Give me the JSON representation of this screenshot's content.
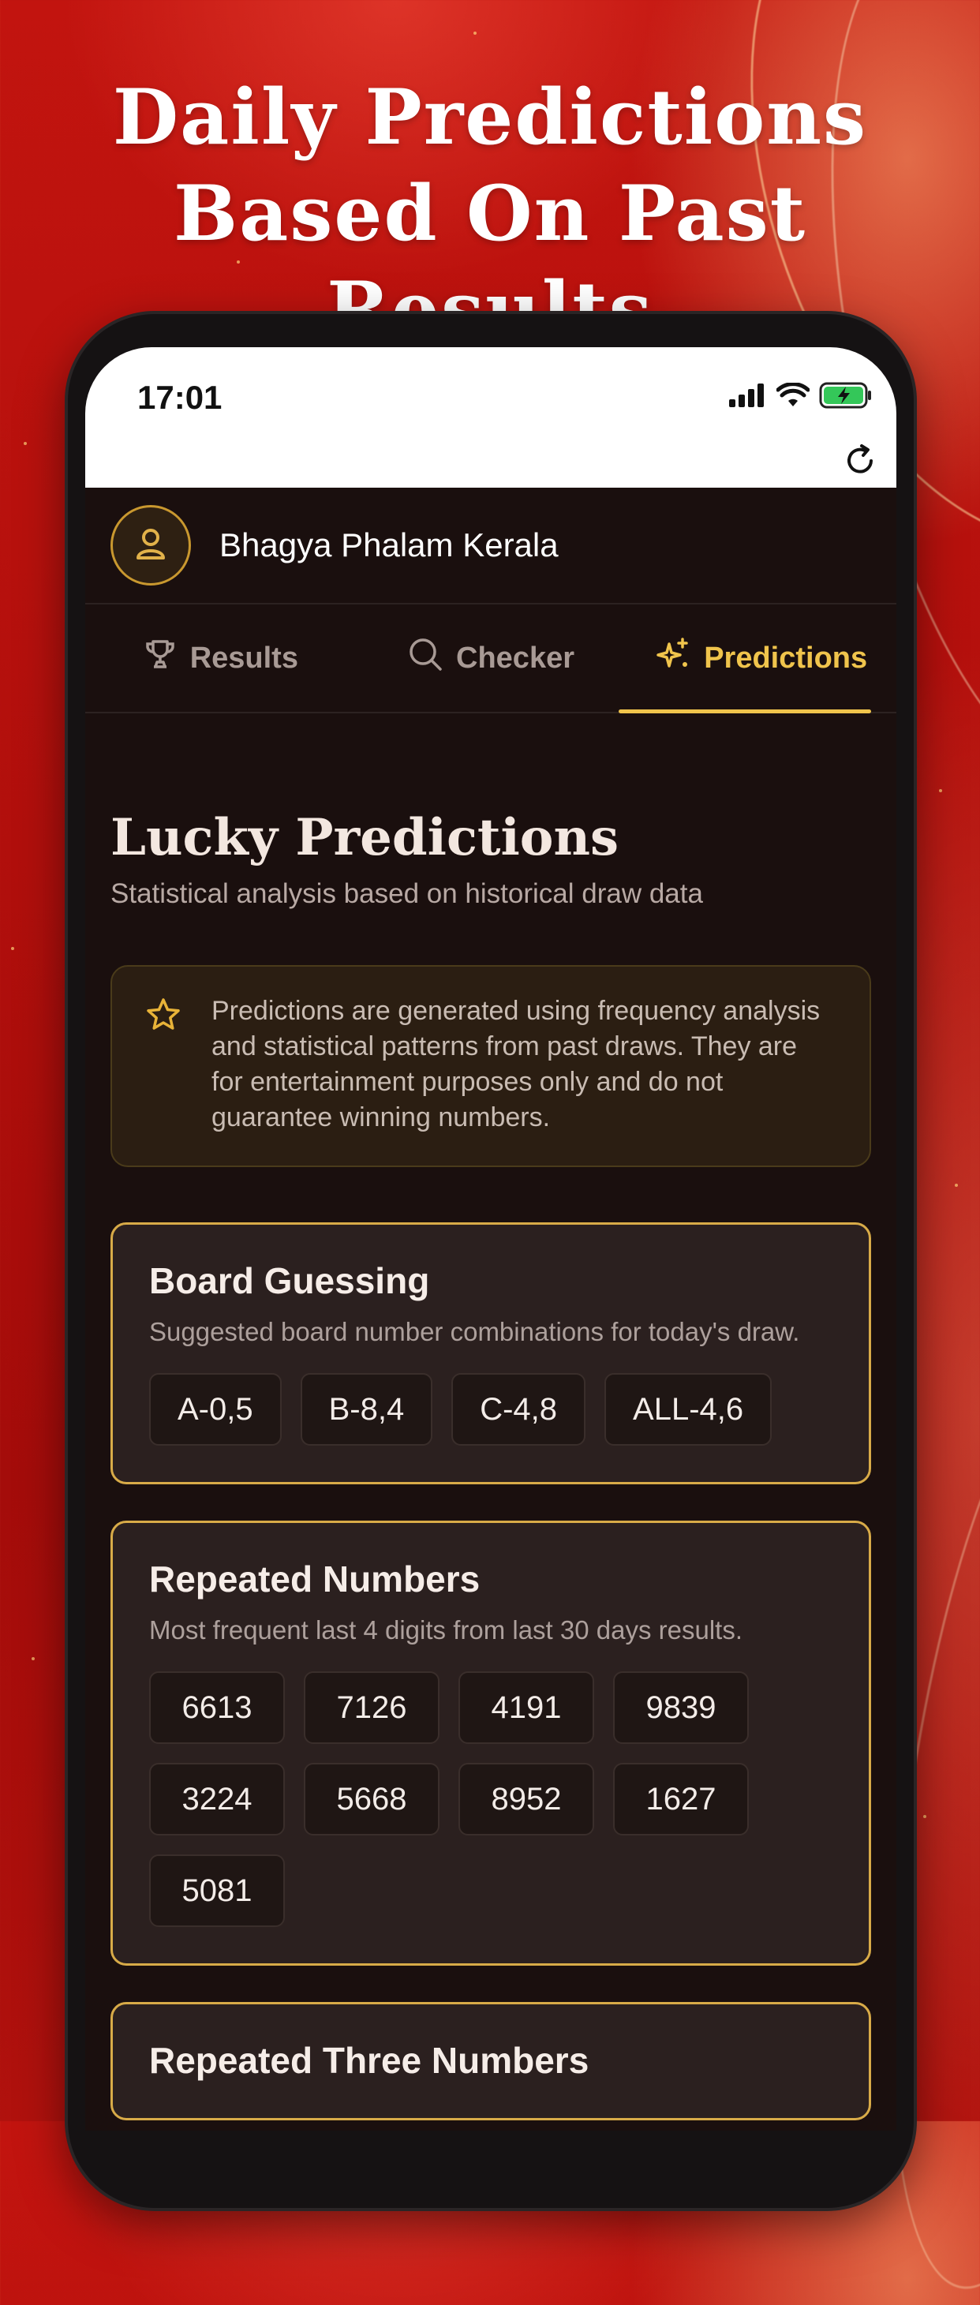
{
  "headline": {
    "line1": "Daily Predictions",
    "line2": "Based On Past Results"
  },
  "status_bar": {
    "time": "17:01"
  },
  "app": {
    "title": "Bhagya Phalam Kerala"
  },
  "tabs": [
    {
      "label": "Results",
      "icon": "trophy-icon"
    },
    {
      "label": "Checker",
      "icon": "search-icon"
    },
    {
      "label": "Predictions",
      "icon": "sparkles-icon",
      "active": true
    }
  ],
  "page": {
    "title": "Lucky Predictions",
    "subtitle": "Statistical analysis based on historical draw data"
  },
  "notice": {
    "icon": "star-icon",
    "text": "Predictions are generated using frequency analysis and statistical patterns from past draws. They are for entertainment purposes only and do not guarantee winning numbers."
  },
  "board_guessing": {
    "title": "Board Guessing",
    "subtitle": "Suggested board number combinations for today's draw.",
    "chips": [
      "A-0,5",
      "B-8,4",
      "C-4,8",
      "ALL-4,6"
    ]
  },
  "repeated_numbers": {
    "title": "Repeated Numbers",
    "subtitle": "Most frequent last 4 digits from last 30 days results.",
    "chips": [
      "6613",
      "7126",
      "4191",
      "9839",
      "3224",
      "5668",
      "8952",
      "1627",
      "5081"
    ]
  },
  "repeated_three": {
    "title": "Repeated Three Numbers"
  },
  "colors": {
    "accent": "#f0c44c",
    "card_border": "#d8ab48",
    "background": "#1a0f0e"
  }
}
